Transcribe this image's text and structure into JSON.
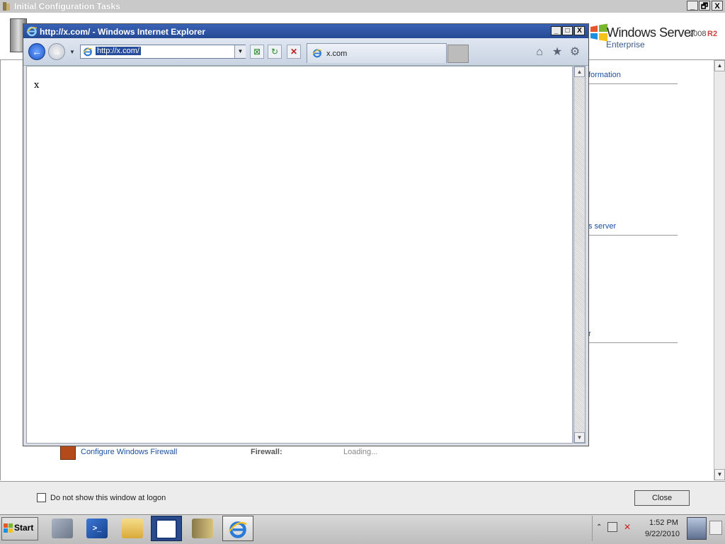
{
  "background_window": {
    "title": "Initial Configuration Tasks",
    "controls": {
      "minimize": "_",
      "restore": "🗗",
      "close": "X"
    },
    "brand": {
      "name": "Windows Server",
      "version": "2008",
      "r2": "R2",
      "edition": "Enterprise"
    },
    "partial_links": [
      "formation",
      "s server",
      "r"
    ],
    "firewall_row": {
      "link": "Configure Windows Firewall",
      "label": "Firewall:",
      "value": "Loading..."
    },
    "footer": {
      "checkbox_label": "Do not show this window at logon",
      "checkbox_checked": false,
      "close_button": "Close"
    }
  },
  "ie_window": {
    "title": "http://x.com/ - Windows Internet Explorer",
    "controls": {
      "minimize": "_",
      "maximize": "□",
      "close": "X"
    },
    "address": "http://x.com/",
    "tab_title": "x.com",
    "page_text": "x",
    "icons": [
      "back-icon",
      "forward-icon",
      "compat-view-icon",
      "refresh-icon",
      "stop-icon",
      "home-icon",
      "favorites-star-icon",
      "tools-gear-icon"
    ]
  },
  "taskbar": {
    "start_label": "Start",
    "apps": [
      "server-manager",
      "powershell",
      "windows-explorer",
      "active-window",
      "initial-configuration-tasks",
      "internet-explorer"
    ],
    "clock_time": "1:52 PM",
    "clock_date": "9/22/2010"
  },
  "colors": {
    "ie_titlebar": "#254a94",
    "address_selection": "#264c9c",
    "link": "#1a4fa0"
  }
}
